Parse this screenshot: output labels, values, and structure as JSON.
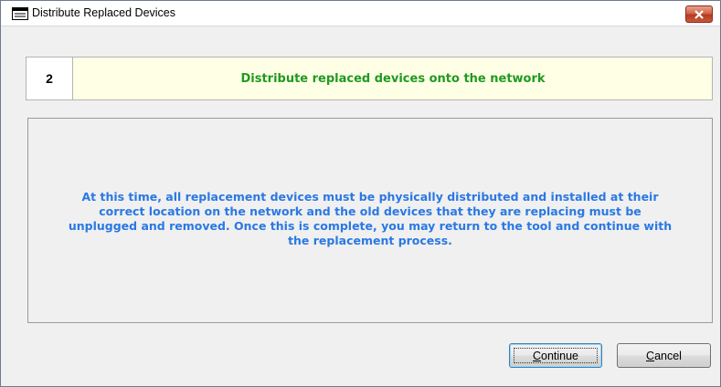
{
  "window": {
    "title": "Distribute Replaced Devices",
    "icon": "window-form-icon",
    "close_icon": "close-icon",
    "close_color": "#c9573c"
  },
  "step": {
    "number": "2",
    "title": "Distribute replaced devices onto the network",
    "title_color": "#1f9a1f",
    "background_color": "#ffffe6"
  },
  "message": {
    "text": "At this time, all replacement devices must be physically distributed and installed at their correct location on the network and the old devices that they are replacing must be unplugged and removed.  Once this is complete, you may return to the tool and continue with the replacement process.",
    "color": "#2a78e4"
  },
  "buttons": {
    "continue_label": "Continue",
    "continue_accelerator": "C",
    "cancel_label": "Cancel",
    "cancel_accelerator": "C"
  }
}
